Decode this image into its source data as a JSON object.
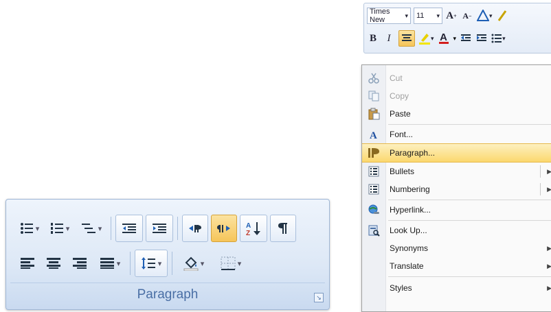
{
  "paragraph_group": {
    "label": "Paragraph",
    "launcher_glyph": "↘",
    "row1": [
      "bullets",
      "numbering",
      "multilevel-list",
      "decrease-indent",
      "increase-indent",
      "ltr-direction",
      "rtl-direction",
      "sort",
      "show-marks"
    ],
    "row2": [
      "align-left",
      "center",
      "align-right",
      "justify",
      "line-spacing",
      "shading",
      "borders"
    ],
    "active_button": "rtl-direction"
  },
  "mini_toolbar": {
    "font_name": "Times New",
    "font_size": "11",
    "bold": "B",
    "italic": "I",
    "grow_font": "A",
    "shrink_font": "A",
    "font_color_letter": "A"
  },
  "context_menu": {
    "items": [
      {
        "label": "Cut",
        "icon": "scissors-icon",
        "enabled": false
      },
      {
        "label": "Copy",
        "icon": "copy-icon",
        "enabled": false
      },
      {
        "label": "Paste",
        "icon": "paste-icon",
        "enabled": true
      },
      {
        "label": "Font...",
        "icon": "font-icon",
        "enabled": true
      },
      {
        "label": "Paragraph...",
        "icon": "paragraph-icon",
        "enabled": true,
        "highlighted": true
      },
      {
        "label": "Bullets",
        "icon": "bullets-icon",
        "enabled": true,
        "submenu": true
      },
      {
        "label": "Numbering",
        "icon": "numbering-icon",
        "enabled": true,
        "submenu": true
      },
      {
        "label": "Hyperlink...",
        "icon": "hyperlink-icon",
        "enabled": true
      },
      {
        "label": "Look Up...",
        "icon": "lookup-icon",
        "enabled": true
      },
      {
        "label": "Synonyms",
        "icon": "",
        "enabled": true,
        "submenu": true
      },
      {
        "label": "Translate",
        "icon": "",
        "enabled": true,
        "submenu": true
      },
      {
        "label": "Styles",
        "icon": "",
        "enabled": true,
        "submenu": true
      }
    ]
  },
  "colors": {
    "ribbon_bg": "#dde8f6",
    "highlight": "#fbd86e",
    "label_blue": "#4a6fa5"
  }
}
